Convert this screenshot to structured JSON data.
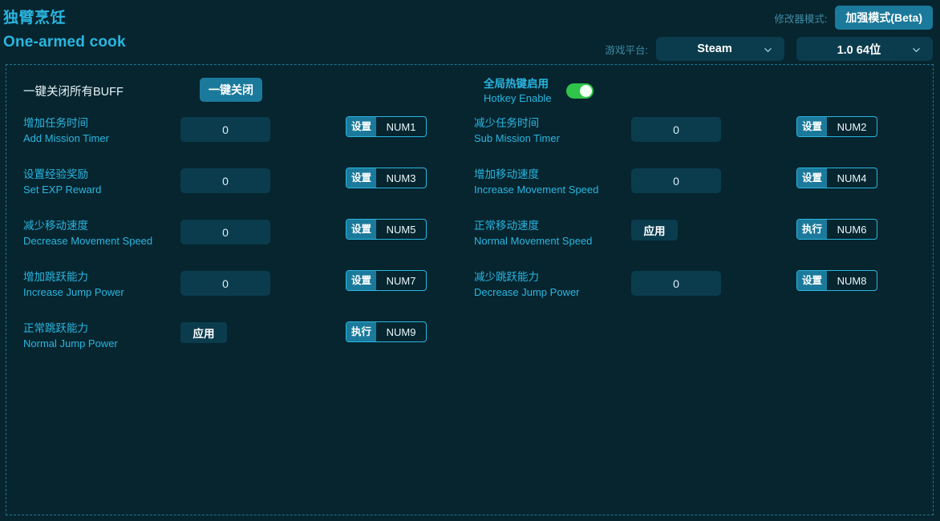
{
  "header": {
    "title_cn": "独臂烹饪",
    "title_en": "One-armed cook",
    "mode_label": "修改器模式:",
    "mode_button": "加强模式(Beta)",
    "platform_label": "游戏平台:",
    "platform_value": "Steam",
    "version_value": "1.0 64位",
    "accent": "#2ab6e0",
    "button_blue": "#1b7a9c",
    "field_bg": "#0b3c4d",
    "page_bg": "#06252f"
  },
  "top_strip": {
    "buff_label": "一键关闭所有BUFF",
    "close_all_button": "一键关闭",
    "hotkey_cn": "全局热键启用",
    "hotkey_en": "Hotkey Enable",
    "hotkey_toggle_on": "on",
    "toggle_color": "#30c44a"
  },
  "rows": [
    {
      "label_cn": "增加任务时间",
      "label_en": "Add Mission Timer",
      "control": "input",
      "value": "0",
      "hotkey_action": "设置",
      "hotkey_key": "NUM1"
    },
    {
      "label_cn": "减少任务时间",
      "label_en": "Sub Mission Timer",
      "control": "input",
      "value": "0",
      "hotkey_action": "设置",
      "hotkey_key": "NUM2"
    },
    {
      "label_cn": "设置经验奖励",
      "label_en": "Set EXP Reward",
      "control": "input",
      "value": "0",
      "hotkey_action": "设置",
      "hotkey_key": "NUM3"
    },
    {
      "label_cn": "增加移动速度",
      "label_en": "Increase Movement Speed",
      "control": "input",
      "value": "0",
      "hotkey_action": "设置",
      "hotkey_key": "NUM4"
    },
    {
      "label_cn": "减少移动速度",
      "label_en": "Decrease Movement Speed",
      "control": "input",
      "value": "0",
      "hotkey_action": "设置",
      "hotkey_key": "NUM5"
    },
    {
      "label_cn": "正常移动速度",
      "label_en": "Normal Movement Speed",
      "control": "button",
      "value": "应用",
      "hotkey_action": "执行",
      "hotkey_key": "NUM6"
    },
    {
      "label_cn": "增加跳跃能力",
      "label_en": "Increase Jump Power",
      "control": "input",
      "value": "0",
      "hotkey_action": "设置",
      "hotkey_key": "NUM7"
    },
    {
      "label_cn": "减少跳跃能力",
      "label_en": "Decrease Jump Power",
      "control": "input",
      "value": "0",
      "hotkey_action": "设置",
      "hotkey_key": "NUM8"
    },
    {
      "label_cn": "正常跳跃能力",
      "label_en": "Normal Jump Power",
      "control": "button",
      "value": "应用",
      "hotkey_action": "执行",
      "hotkey_key": "NUM9"
    }
  ]
}
